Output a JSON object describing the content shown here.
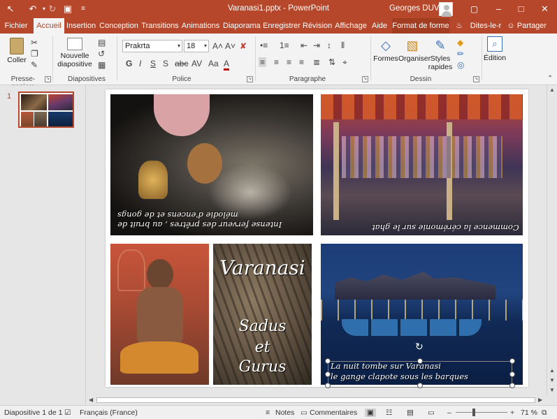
{
  "window": {
    "title": "Varanasi1.pptx - PowerPoint",
    "user": "Georges DUVAL"
  },
  "tabs": [
    "Fichier",
    "Accueil",
    "Insertion",
    "Conception",
    "Transitions",
    "Animations",
    "Diaporama",
    "Enregistrer",
    "Révision",
    "Affichage",
    "Aide",
    "Format de forme",
    "Dites-le-r",
    "Partager"
  ],
  "ribbon": {
    "clipboard": {
      "paste": "Coller",
      "label": "Presse-papiers"
    },
    "slides": {
      "new_slide_line1": "Nouvelle",
      "new_slide_line2": "diapositive",
      "label": "Diapositives"
    },
    "font": {
      "name": "Prakrta",
      "size": "18",
      "label": "Police"
    },
    "paragraph": {
      "label": "Paragraphe"
    },
    "drawing": {
      "shapes": "Formes",
      "arrange": "Organiser",
      "styles_line1": "Styles",
      "styles_line2": "rapides",
      "label": "Dessin"
    },
    "editing": {
      "label": "Édition"
    }
  },
  "slide_panel": {
    "number": "1"
  },
  "slide": {
    "caption_top_left": [
      "Intense ferveur des prêtres , au bruit de",
      "mélodie d'encens et de gongs"
    ],
    "caption_top_right": "Commence la cérémonie sur le ghat",
    "title_varanasi": "Varanasi",
    "title_sadus": "Sadus",
    "title_et": "et",
    "title_gurus": "Gurus",
    "caption_bottom_right": [
      "La nuit tombe sur Varanasi",
      "le gange clapote sous les barques"
    ]
  },
  "status": {
    "slide_count": "Diapositive 1 de 1",
    "language": "Français (France)",
    "notes": "Notes",
    "comments": "Commentaires",
    "zoom": "71 %"
  },
  "colors": {
    "accent": "#b7472a"
  }
}
